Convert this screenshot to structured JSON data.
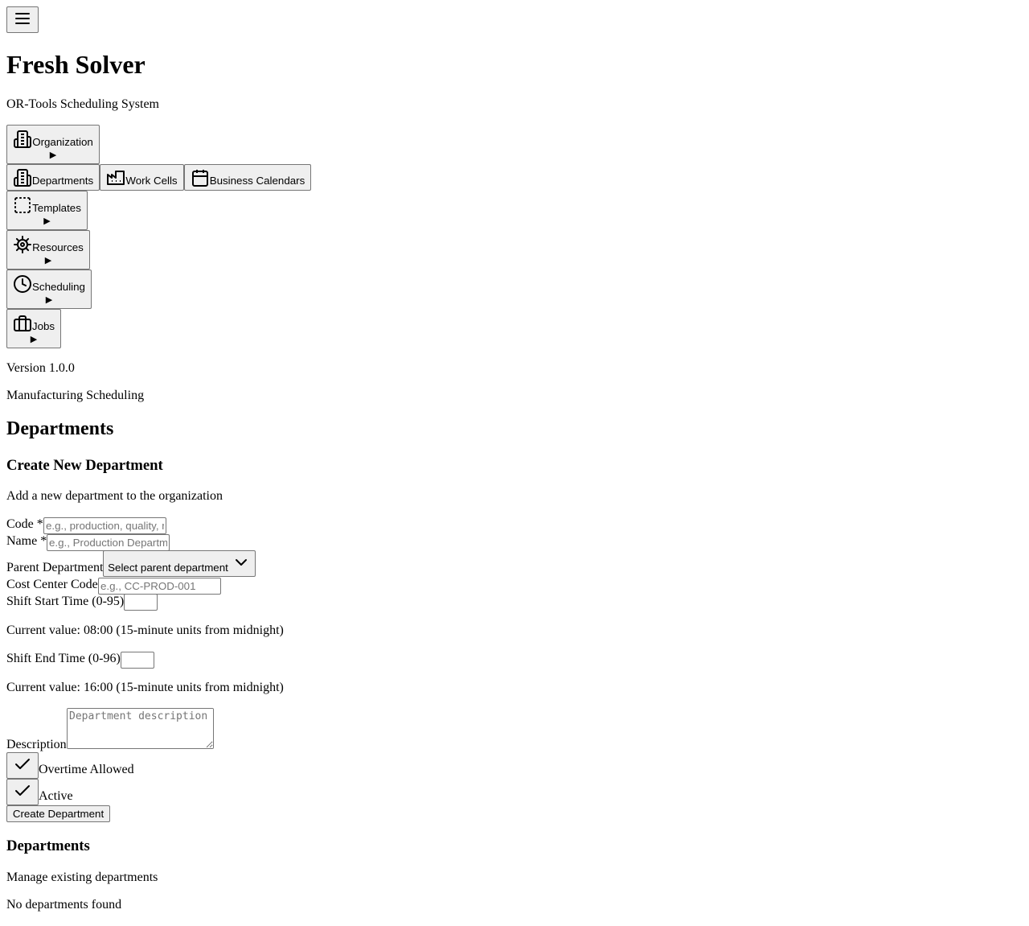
{
  "header": {
    "menu_icon": "hamburger-icon",
    "app_title": "Fresh Solver",
    "app_subtitle": "OR-Tools Scheduling System"
  },
  "nav": {
    "organization": {
      "label": "Organization",
      "icon": "building-icon",
      "expanded": true
    },
    "organization_children": [
      {
        "label": "Departments",
        "icon": "building-icon"
      },
      {
        "label": "Work Cells",
        "icon": "factory-icon"
      },
      {
        "label": "Business Calendars",
        "icon": "calendar-icon"
      }
    ],
    "templates": {
      "label": "Templates",
      "icon": "dashed-square-icon"
    },
    "resources": {
      "label": "Resources",
      "icon": "gear-icon"
    },
    "scheduling": {
      "label": "Scheduling",
      "icon": "clock-icon"
    },
    "jobs": {
      "label": "Jobs",
      "icon": "briefcase-icon"
    },
    "collapse_glyph": "▶"
  },
  "footer_info": {
    "version": "Version 1.0.0",
    "tagline": "Manufacturing Scheduling"
  },
  "page": {
    "title": "Departments"
  },
  "create_form": {
    "title": "Create New Department",
    "description": "Add a new department to the organization",
    "code_label": "Code *",
    "code_placeholder": "e.g., production, quality, maintenance",
    "name_label": "Name *",
    "name_placeholder": "e.g., Production Department",
    "parent_label": "Parent Department",
    "parent_select_value": "Select parent department",
    "cost_center_label": "Cost Center Code",
    "cost_center_placeholder": "e.g., CC-PROD-001",
    "shift_start_label": "Shift Start Time (0-95)",
    "shift_start_value": "",
    "shift_start_help": "Current value: 08:00 (15-minute units from midnight)",
    "shift_end_label": "Shift End Time (0-96)",
    "shift_end_value": "",
    "shift_end_help": "Current value: 16:00 (15-minute units from midnight)",
    "description_label": "Description",
    "description_placeholder": "Department description and responsibilities",
    "overtime_label": "Overtime Allowed",
    "overtime_checked": true,
    "active_label": "Active",
    "active_checked": true,
    "submit_label": "Create Department"
  },
  "list_section": {
    "title": "Departments",
    "description": "Manage existing departments",
    "empty_message": "No departments found"
  }
}
